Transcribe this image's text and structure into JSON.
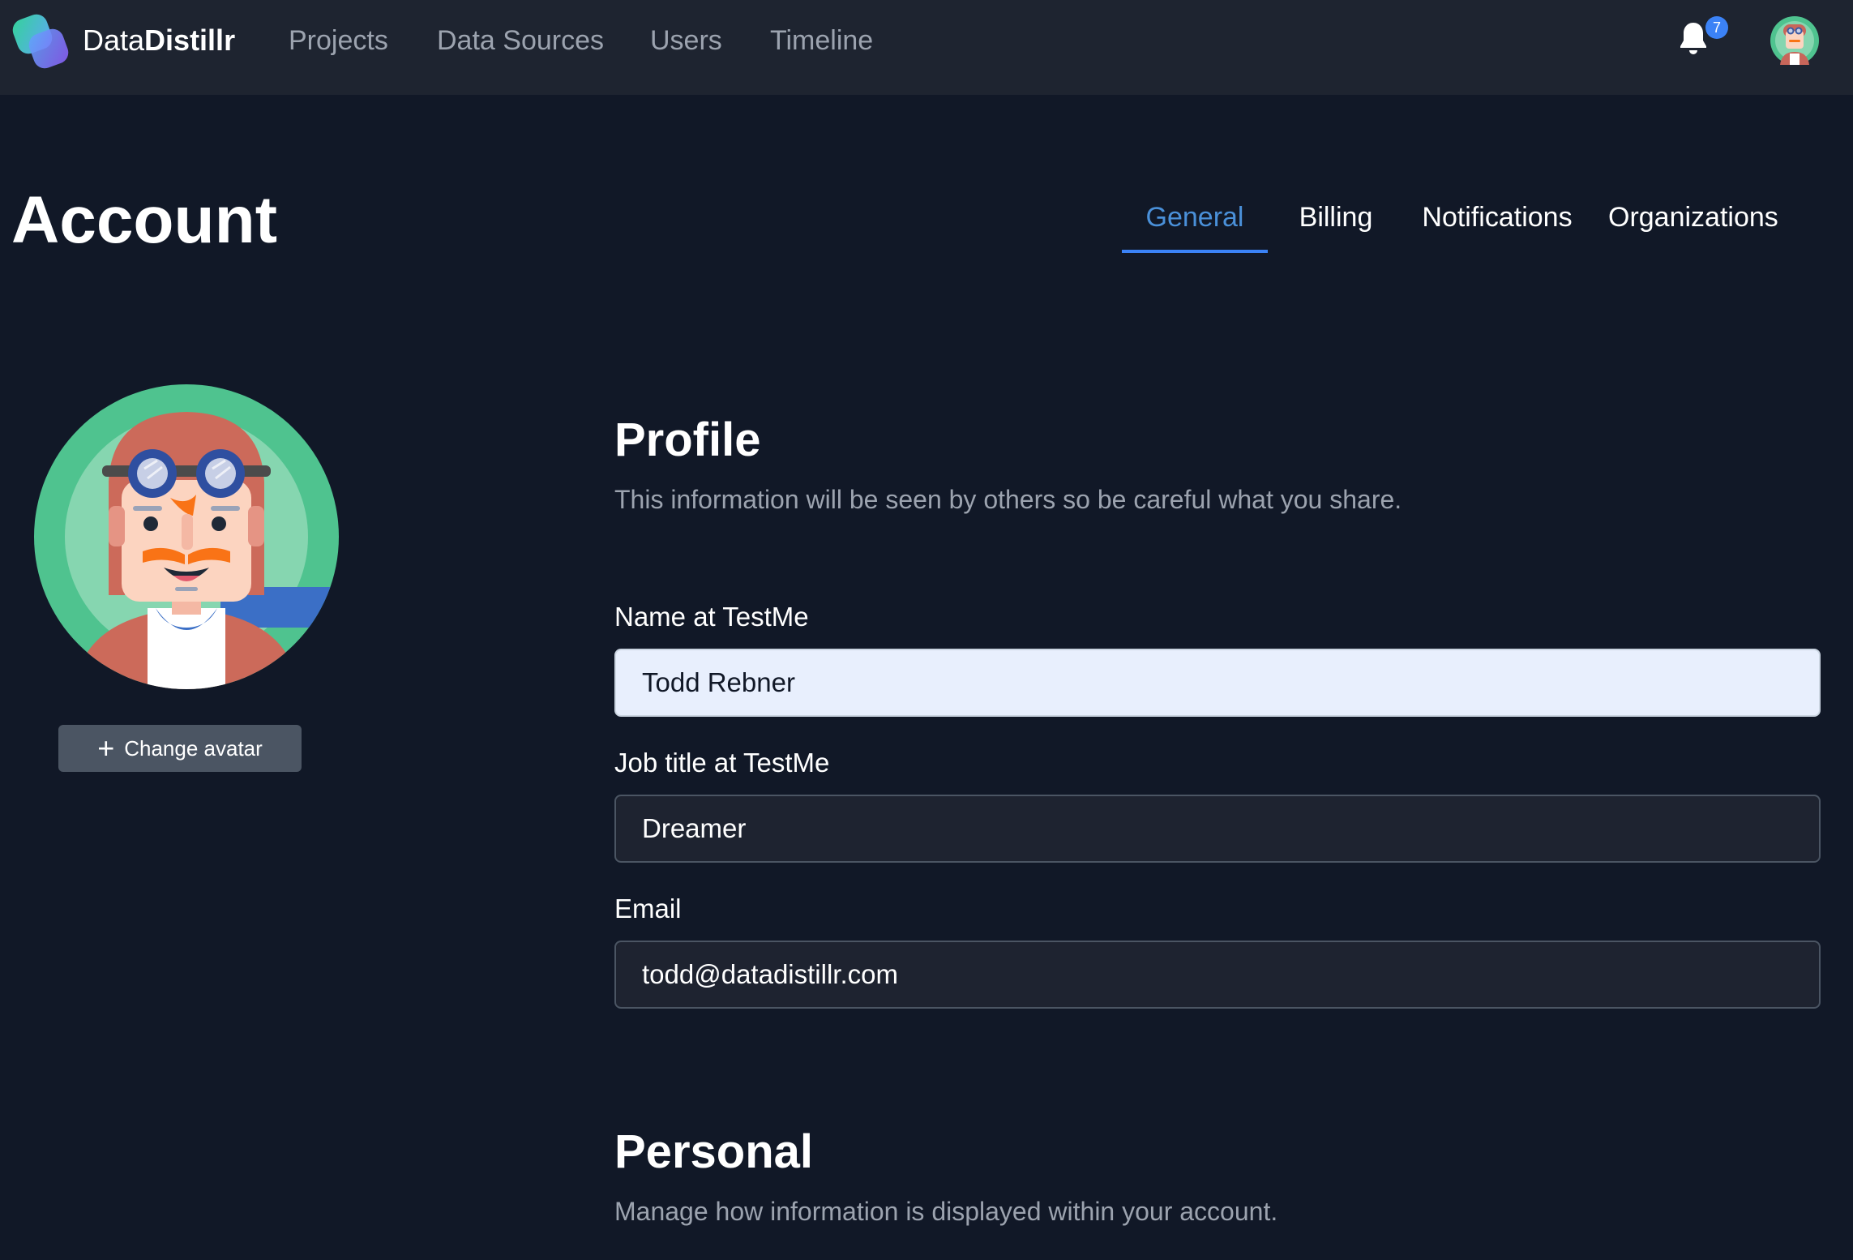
{
  "app": {
    "brand_light": "Data",
    "brand_bold": "Distillr"
  },
  "nav": {
    "items": [
      "Projects",
      "Data Sources",
      "Users",
      "Timeline"
    ]
  },
  "notifications": {
    "count": "7",
    "icon": "bell-icon"
  },
  "page": {
    "title": "Account"
  },
  "tabs": [
    {
      "label": "General",
      "active": true
    },
    {
      "label": "Billing",
      "active": false
    },
    {
      "label": "Notifications",
      "active": false
    },
    {
      "label": "Organizations",
      "active": false
    }
  ],
  "avatar": {
    "change_label": "Change avatar",
    "icon": "plus-icon"
  },
  "profile": {
    "title": "Profile",
    "description": "This information will be seen by others so be careful what you share.",
    "fields": [
      {
        "label": "Name at TestMe",
        "value": "Todd Rebner"
      },
      {
        "label": "Job title at TestMe",
        "value": "Dreamer"
      },
      {
        "label": "Email",
        "value": "todd@datadistillr.com"
      }
    ]
  },
  "personal": {
    "title": "Personal",
    "description": "Manage how information is displayed within your account."
  },
  "colors": {
    "accent": "#3b82f6",
    "background": "#111827",
    "topbar": "#1e2430"
  }
}
